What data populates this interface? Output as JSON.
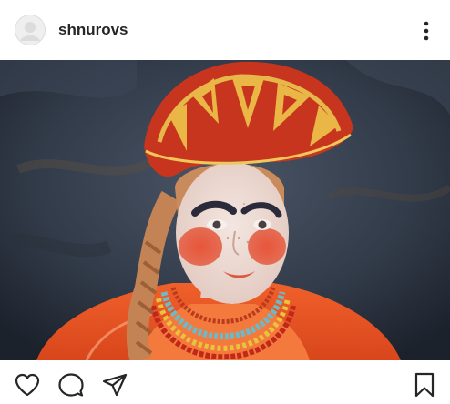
{
  "post": {
    "username": "shnurovs",
    "avatar_icon": "default-avatar-icon",
    "more_icon": "more-vertical-icon",
    "photo_alt": "",
    "actions": {
      "like_icon": "heart-icon",
      "comment_icon": "comment-icon",
      "share_icon": "paper-plane-icon",
      "save_icon": "bookmark-icon"
    }
  },
  "colors": {
    "text": "#262626",
    "background": "#ffffff",
    "icon": "#262626"
  }
}
